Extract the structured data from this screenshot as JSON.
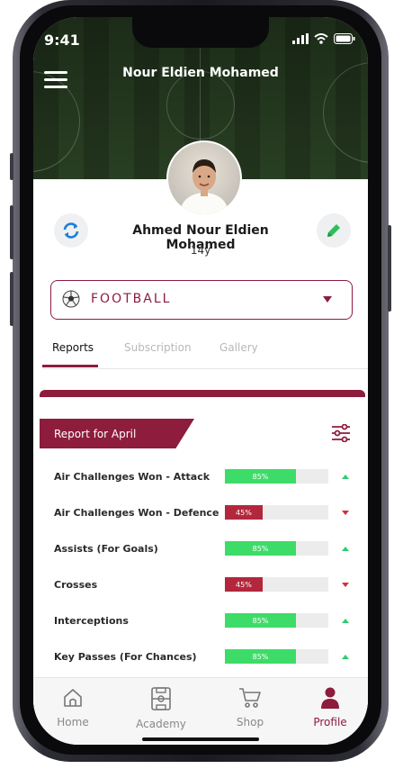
{
  "status": {
    "time": "9:41"
  },
  "header": {
    "title": "Nour Eldien Mohamed"
  },
  "player": {
    "name": "Ahmed Nour Eldien Mohamed",
    "age": "14y"
  },
  "sport": {
    "label": "FOOTBALL"
  },
  "tabs": [
    {
      "label": "Reports",
      "active": true
    },
    {
      "label": "Subscription",
      "active": false
    },
    {
      "label": "Gallery",
      "active": false
    }
  ],
  "report": {
    "title": "Report for April",
    "rows": [
      {
        "label": "Air Challenges Won - Attack",
        "value": "85%",
        "percent": 85,
        "trend": "up",
        "color": "#3ddc68"
      },
      {
        "label": "Air Challenges Won - Defence",
        "value": "45%",
        "percent": 45,
        "trend": "down",
        "color": "#b3273c"
      },
      {
        "label": "Assists (For Goals)",
        "value": "85%",
        "percent": 85,
        "trend": "up",
        "color": "#3ddc68"
      },
      {
        "label": "Crosses",
        "value": "45%",
        "percent": 45,
        "trend": "down",
        "color": "#b3273c"
      },
      {
        "label": "Interceptions",
        "value": "85%",
        "percent": 85,
        "trend": "up",
        "color": "#3ddc68"
      },
      {
        "label": "Key Passes (For Chances)",
        "value": "85%",
        "percent": 85,
        "trend": "up",
        "color": "#3ddc68"
      }
    ]
  },
  "bottom_nav": [
    {
      "label": "Home",
      "icon": "home-icon",
      "active": false
    },
    {
      "label": "Academy",
      "icon": "pitch-icon",
      "active": false
    },
    {
      "label": "Shop",
      "icon": "cart-icon",
      "active": false
    },
    {
      "label": "Profile",
      "icon": "person-icon",
      "active": true
    }
  ],
  "colors": {
    "brand": "#8d1c3d",
    "positive": "#3ddc68",
    "negative": "#d0303a"
  }
}
